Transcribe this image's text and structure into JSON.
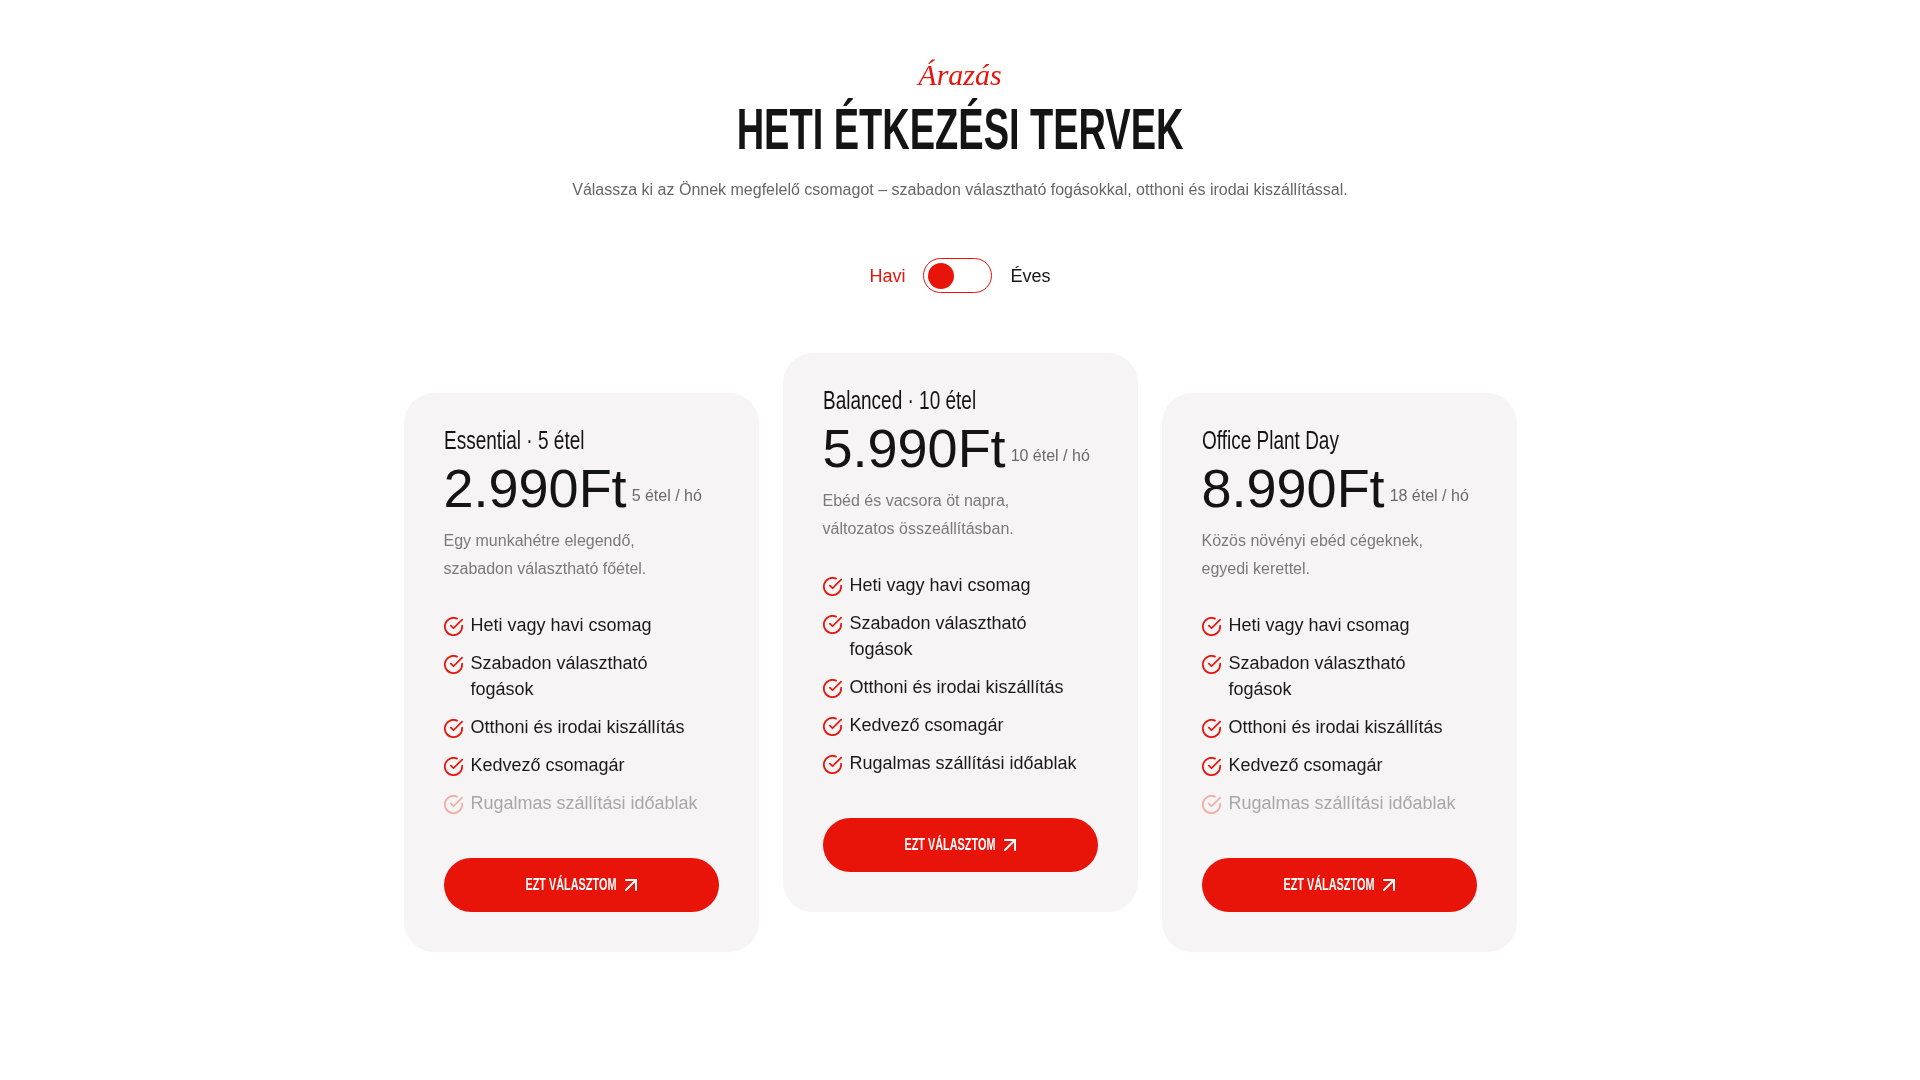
{
  "header": {
    "eyebrow": "Árazás",
    "title": "HETI ÉTKEZÉSI TERVEK",
    "subtitle": "Válassza ki az Önnek megfelelő csomagot – szabadon választható fogásokkal, otthoni és irodai kiszállítással."
  },
  "billing": {
    "options": [
      {
        "label": "Havi",
        "selected": true
      },
      {
        "label": "Éves",
        "selected": false
      }
    ]
  },
  "plans": [
    {
      "name": "Essential · 5 étel",
      "price": "2.990Ft",
      "unit": "5 étel / hó",
      "description": "Egy munkahétre elegendő, szabadon választható főétel.",
      "featured": false,
      "features": [
        {
          "text": "Heti vagy havi csomag",
          "included": true
        },
        {
          "text": "Szabadon választható fogások",
          "included": true
        },
        {
          "text": "Otthoni és irodai kiszállítás",
          "included": true
        },
        {
          "text": "Kedvező csomagár",
          "included": true
        },
        {
          "text": "Rugalmas szállítási időablak",
          "included": false
        }
      ],
      "button": "EZT VÁLASZTOM"
    },
    {
      "name": "Balanced · 10 étel",
      "price": "5.990Ft",
      "unit": "10 étel / hó",
      "description": "Ebéd és vacsora öt napra, változatos összeállításban.",
      "featured": true,
      "features": [
        {
          "text": "Heti vagy havi csomag",
          "included": true
        },
        {
          "text": "Szabadon választható fogások",
          "included": true
        },
        {
          "text": "Otthoni és irodai kiszállítás",
          "included": true
        },
        {
          "text": "Kedvező csomagár",
          "included": true
        },
        {
          "text": "Rugalmas szállítási időablak",
          "included": true
        }
      ],
      "button": "EZT VÁLASZTOM"
    },
    {
      "name": "Office Plant Day",
      "price": "8.990Ft",
      "unit": "18 étel / hó",
      "description": "Közös növényi ebéd cégeknek, egyedi kerettel.",
      "featured": false,
      "features": [
        {
          "text": "Heti vagy havi csomag",
          "included": true
        },
        {
          "text": "Szabadon választható fogások",
          "included": true
        },
        {
          "text": "Otthoni és irodai kiszállítás",
          "included": true
        },
        {
          "text": "Kedvező csomagár",
          "included": true
        },
        {
          "text": "Rugalmas szállítási időablak",
          "included": false
        }
      ],
      "button": "EZT VÁLASZTOM"
    }
  ]
}
